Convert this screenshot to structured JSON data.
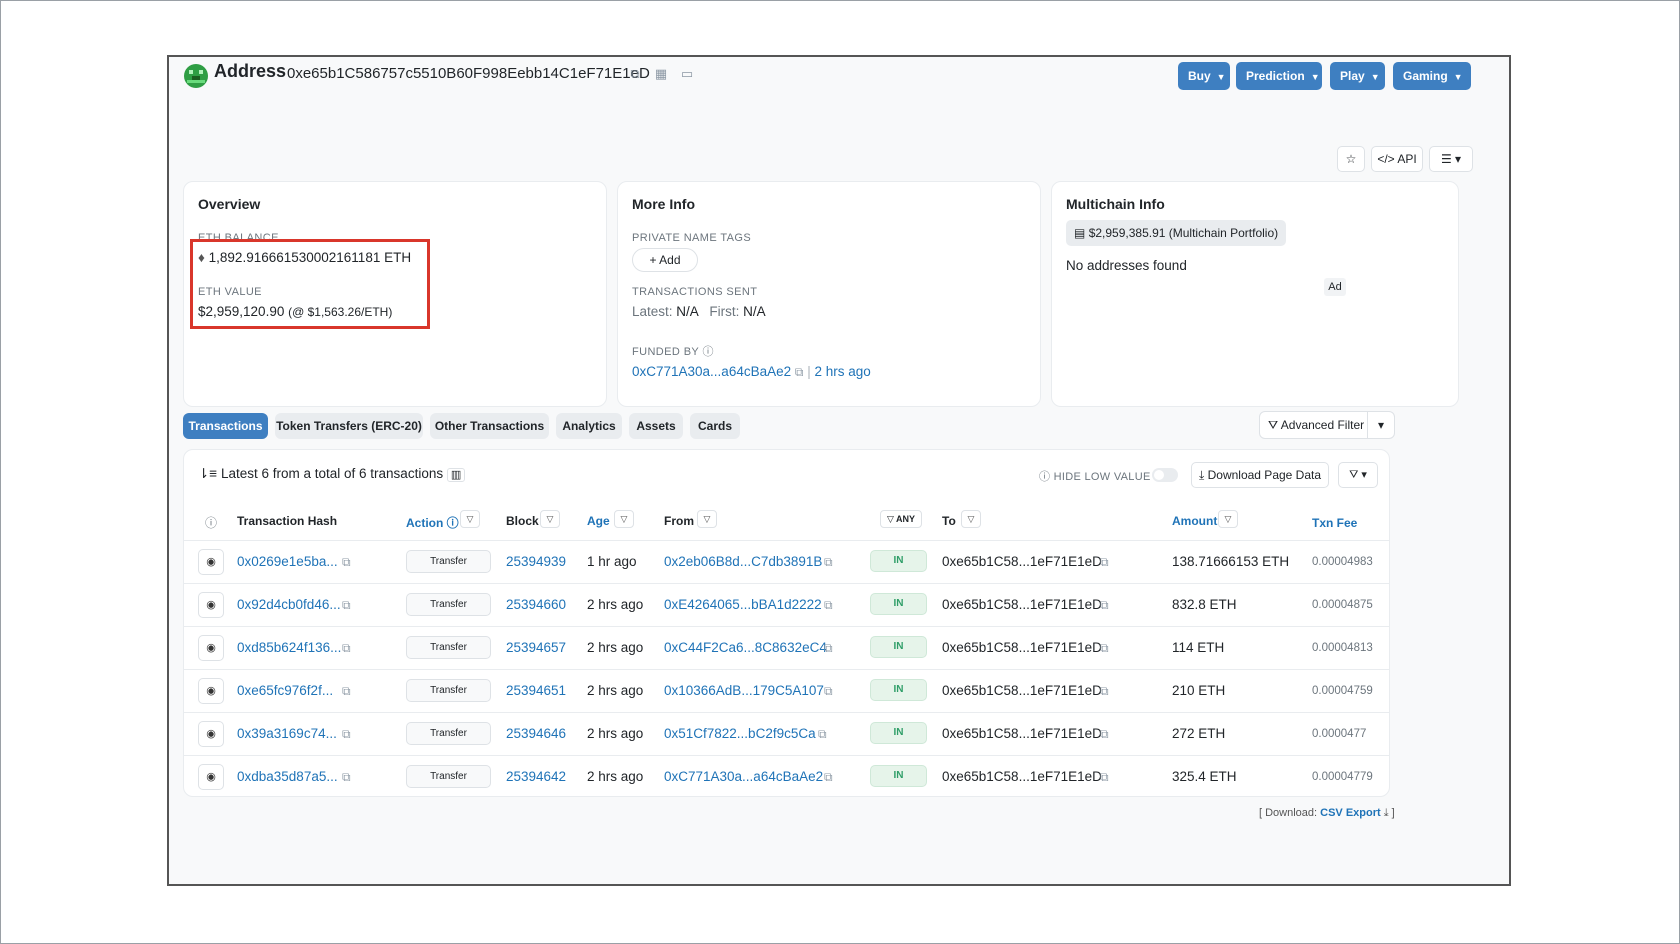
{
  "header": {
    "title": "Address",
    "address": "0xe65b1C586757c5510B60F998Eebb14C1eF71E1eD",
    "nav": [
      "Buy",
      "Prediction",
      "Play",
      "Gaming"
    ]
  },
  "toolbar": {
    "api_label": "</> API"
  },
  "overview": {
    "title": "Overview",
    "eth_balance_label": "ETH BALANCE",
    "eth_balance": "1,892.916661530002161181 ETH",
    "eth_value_label": "ETH VALUE",
    "eth_value": "$2,959,120.90",
    "eth_price": "(@ $1,563.26/ETH)"
  },
  "more_info": {
    "title": "More Info",
    "private_tags_label": "PRIVATE NAME TAGS",
    "add_label": "+ Add",
    "tx_sent_label": "TRANSACTIONS SENT",
    "latest_label": "Latest:",
    "latest_value": "N/A",
    "first_label": "First:",
    "first_value": "N/A",
    "funded_by_label": "FUNDED BY",
    "funded_by": "0xC771A30a...a64cBaAe2",
    "funded_age": "2 hrs ago"
  },
  "multichain": {
    "title": "Multichain Info",
    "portfolio": "$2,959,385.91 (Multichain Portfolio)",
    "no_addresses": "No addresses found",
    "ad": "Ad"
  },
  "tabs": [
    "Transactions",
    "Token Transfers (ERC-20)",
    "Other Transactions",
    "Analytics",
    "Assets",
    "Cards"
  ],
  "advanced_filter": "Advanced Filter",
  "table": {
    "summary": "Latest 6 from a total of 6 transactions",
    "hide_low_value": "HIDE LOW VALUE",
    "download": "Download Page Data",
    "headers": {
      "hash": "Transaction Hash",
      "action": "Action",
      "block": "Block",
      "age": "Age",
      "from": "From",
      "any": "ANY",
      "to": "To",
      "amount": "Amount",
      "fee": "Txn Fee"
    },
    "rows": [
      {
        "hash": "0x0269e1e5ba...",
        "method": "Transfer",
        "block": "25394939",
        "age": "1 hr ago",
        "from": "0x2eb06B8d...C7db3891B",
        "dir": "IN",
        "to": "0xe65b1C58...1eF71E1eD",
        "amount": "138.71666153 ETH",
        "fee": "0.00004983"
      },
      {
        "hash": "0x92d4cb0fd46...",
        "method": "Transfer",
        "block": "25394660",
        "age": "2 hrs ago",
        "from": "0xE4264065...bBA1d2222",
        "dir": "IN",
        "to": "0xe65b1C58...1eF71E1eD",
        "amount": "832.8 ETH",
        "fee": "0.00004875"
      },
      {
        "hash": "0xd85b624f136...",
        "method": "Transfer",
        "block": "25394657",
        "age": "2 hrs ago",
        "from": "0xC44F2Ca6...8C8632eC4",
        "dir": "IN",
        "to": "0xe65b1C58...1eF71E1eD",
        "amount": "114 ETH",
        "fee": "0.00004813"
      },
      {
        "hash": "0xe65fc976f2f...",
        "method": "Transfer",
        "block": "25394651",
        "age": "2 hrs ago",
        "from": "0x10366AdB...179C5A107",
        "dir": "IN",
        "to": "0xe65b1C58...1eF71E1eD",
        "amount": "210 ETH",
        "fee": "0.00004759"
      },
      {
        "hash": "0x39a3169c74...",
        "method": "Transfer",
        "block": "25394646",
        "age": "2 hrs ago",
        "from": "0x51Cf7822...bC2f9c5Ca",
        "dir": "IN",
        "to": "0xe65b1C58...1eF71E1eD",
        "amount": "272 ETH",
        "fee": "0.0000477"
      },
      {
        "hash": "0xdba35d87a5...",
        "method": "Transfer",
        "block": "25394642",
        "age": "2 hrs ago",
        "from": "0xC771A30a...a64cBaAe2",
        "dir": "IN",
        "to": "0xe65b1C58...1eF71E1eD",
        "amount": "325.4 ETH",
        "fee": "0.00004779"
      }
    ]
  },
  "csv": {
    "prefix": "[ Download:",
    "link": "CSV Export",
    "suffix": "]"
  }
}
